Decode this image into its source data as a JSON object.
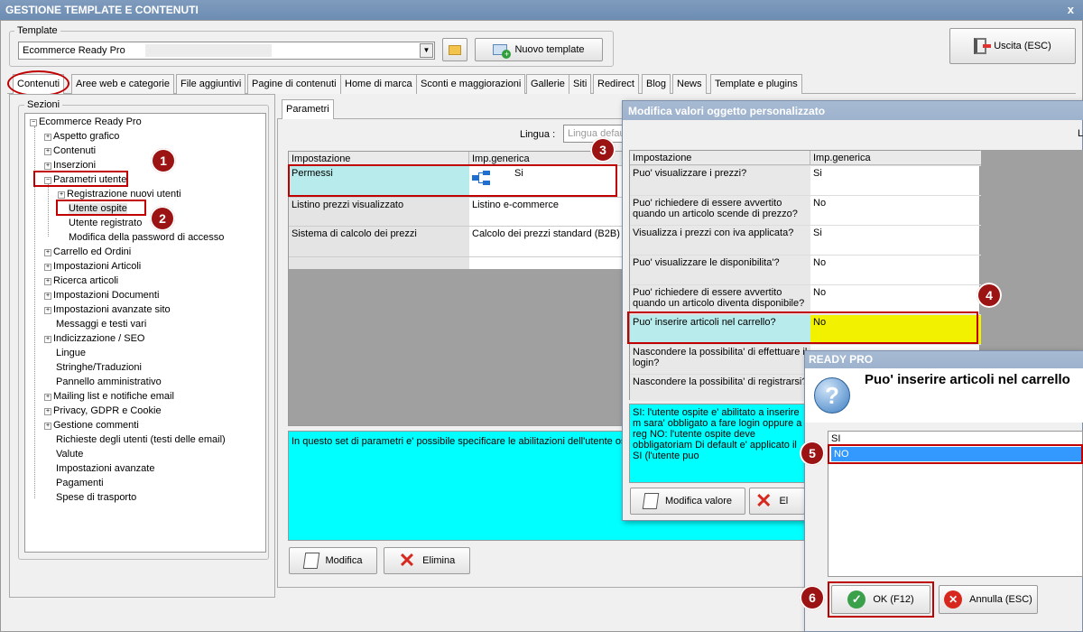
{
  "window": {
    "title": "GESTIONE TEMPLATE E CONTENUTI",
    "close": "x"
  },
  "template": {
    "legend": "Template",
    "value": "Ecommerce Ready Pro",
    "new_button": "Nuovo template",
    "exit_button": "Uscita (ESC)"
  },
  "tabs": [
    "Contenuti",
    "Aree web e categorie",
    "File aggiuntivi",
    "Pagine di contenuti",
    "Home di marca",
    "Sconti e maggiorazioni",
    "Gallerie",
    "Siti",
    "Redirect",
    "Blog",
    "News",
    "Template e plugins"
  ],
  "sections": {
    "legend": "Sezioni",
    "items": [
      "Ecommerce Ready Pro",
      "Aspetto grafico",
      "Contenuti",
      "Inserzioni",
      "Parametri utente",
      "Registrazione nuovi utenti",
      "Utente ospite",
      "Utente registrato",
      "Modifica della password di accesso",
      "Carrello ed Ordini",
      "Impostazioni Articoli",
      "Ricerca articoli",
      "Impostazioni Documenti",
      "Impostazioni avanzate sito",
      "Messaggi e testi vari",
      "Indicizzazione / SEO",
      "Lingue",
      "Stringhe/Traduzioni",
      "Pannello amministrativo",
      "Mailing list e notifiche email",
      "Privacy, GDPR e Cookie",
      "Gestione commenti",
      "Richieste degli utenti (testi delle email)",
      "Valute",
      "Impostazioni avanzate",
      "Pagamenti",
      "Spese di trasporto"
    ]
  },
  "params": {
    "tab": "Parametri",
    "lingua_label": "Lingua :",
    "lingua_value": "Lingua default",
    "col1": "Impostazione",
    "col2": "Imp.generica",
    "rows": [
      [
        "Permessi",
        "Si"
      ],
      [
        "Listino prezzi visualizzato",
        "Listino e-commerce"
      ],
      [
        "Sistema di calcolo dei prezzi",
        "Calcolo dei prezzi standard (B2B)"
      ]
    ],
    "info": "In questo set di parametri e' possibile specificare le abilitazioni dell'utente ospite",
    "modifica": "Modifica",
    "elimina": "Elimina"
  },
  "modal": {
    "title": "Modifica valori oggetto personalizzato",
    "right_label": "L",
    "col1": "Impostazione",
    "col2": "Imp.generica",
    "rows": [
      [
        "Puo' visualizzare i prezzi?",
        "Si"
      ],
      [
        "Puo' richiedere di essere avvertito quando un articolo scende di prezzo?",
        "No"
      ],
      [
        "Visualizza i prezzi con iva applicata?",
        "Si"
      ],
      [
        "Puo' visualizzare le disponibilita'?",
        "No"
      ],
      [
        "Puo' richiedere di essere avvertito quando un articolo diventa disponibile?",
        "No"
      ],
      [
        "Puo' inserire articoli nel carrello?",
        "No"
      ],
      [
        "Nascondere la possibilita' di effettuare il login?",
        ""
      ],
      [
        "Nascondere la possibilita' di registrarsi?",
        ""
      ]
    ],
    "info": "SI: l'utente ospite e' abilitato a inserire m sara' obbligato a fare login oppure a reg NO: l'utente ospite deve obbligatoriam Di default e' applicato il SI (l'utente puo",
    "modifica_valore": "Modifica valore",
    "elimina_short": "El"
  },
  "dialog": {
    "title": "READY PRO",
    "question": "Puo' inserire articoli nel carrello",
    "options": [
      "SI",
      "NO"
    ],
    "ok": "OK (F12)",
    "cancel": "Annulla (ESC)"
  },
  "markers": [
    "1",
    "2",
    "3",
    "4",
    "5",
    "6"
  ],
  "colors": {
    "cyan": "#00ffff",
    "highlight_yellow": "#f2f200",
    "highlight_cyan": "#b8ecec",
    "selected_blue": "#3399ff",
    "marker_red": "#9b1313"
  }
}
